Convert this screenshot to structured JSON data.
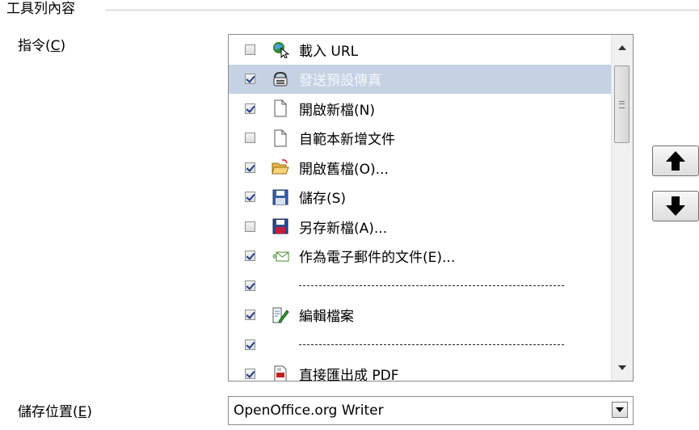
{
  "section_title": "工具列內容",
  "commands_label": {
    "text": "指令(",
    "mnemonic": "C",
    "close": ")"
  },
  "save_location_label": {
    "text": "儲存位置(",
    "mnemonic": "E",
    "close": ")"
  },
  "commands": [
    {
      "checked": false,
      "icon": "globe-url-icon",
      "label": "載入 URL",
      "selected": false
    },
    {
      "checked": true,
      "icon": "fax-icon",
      "label": "發送預設傳真",
      "selected": true
    },
    {
      "checked": true,
      "icon": "new-file-icon",
      "label": "開啟新檔(N)",
      "selected": false
    },
    {
      "checked": false,
      "icon": "new-file-icon",
      "label": "自範本新增文件",
      "selected": false
    },
    {
      "checked": true,
      "icon": "open-folder-icon",
      "label": "開啟舊檔(O)...",
      "selected": false
    },
    {
      "checked": true,
      "icon": "save-icon",
      "label": "儲存(S)",
      "selected": false
    },
    {
      "checked": false,
      "icon": "save-as-icon",
      "label": "另存新檔(A)...",
      "selected": false
    },
    {
      "checked": true,
      "icon": "email-icon",
      "label": "作為電子郵件的文件(E)...",
      "selected": false
    },
    {
      "checked": true,
      "icon": "",
      "label": "",
      "separator": true,
      "selected": false
    },
    {
      "checked": true,
      "icon": "edit-file-icon",
      "label": "編輯檔案",
      "selected": false
    },
    {
      "checked": true,
      "icon": "",
      "label": "",
      "separator": true,
      "selected": false
    },
    {
      "checked": true,
      "icon": "pdf-export-icon",
      "label": "直接匯出成 PDF",
      "selected": false
    }
  ],
  "save_location": {
    "value": "OpenOffice.org Writer"
  },
  "colors": {
    "selection": "#c5d2e4",
    "check": "#1e3d8a"
  }
}
